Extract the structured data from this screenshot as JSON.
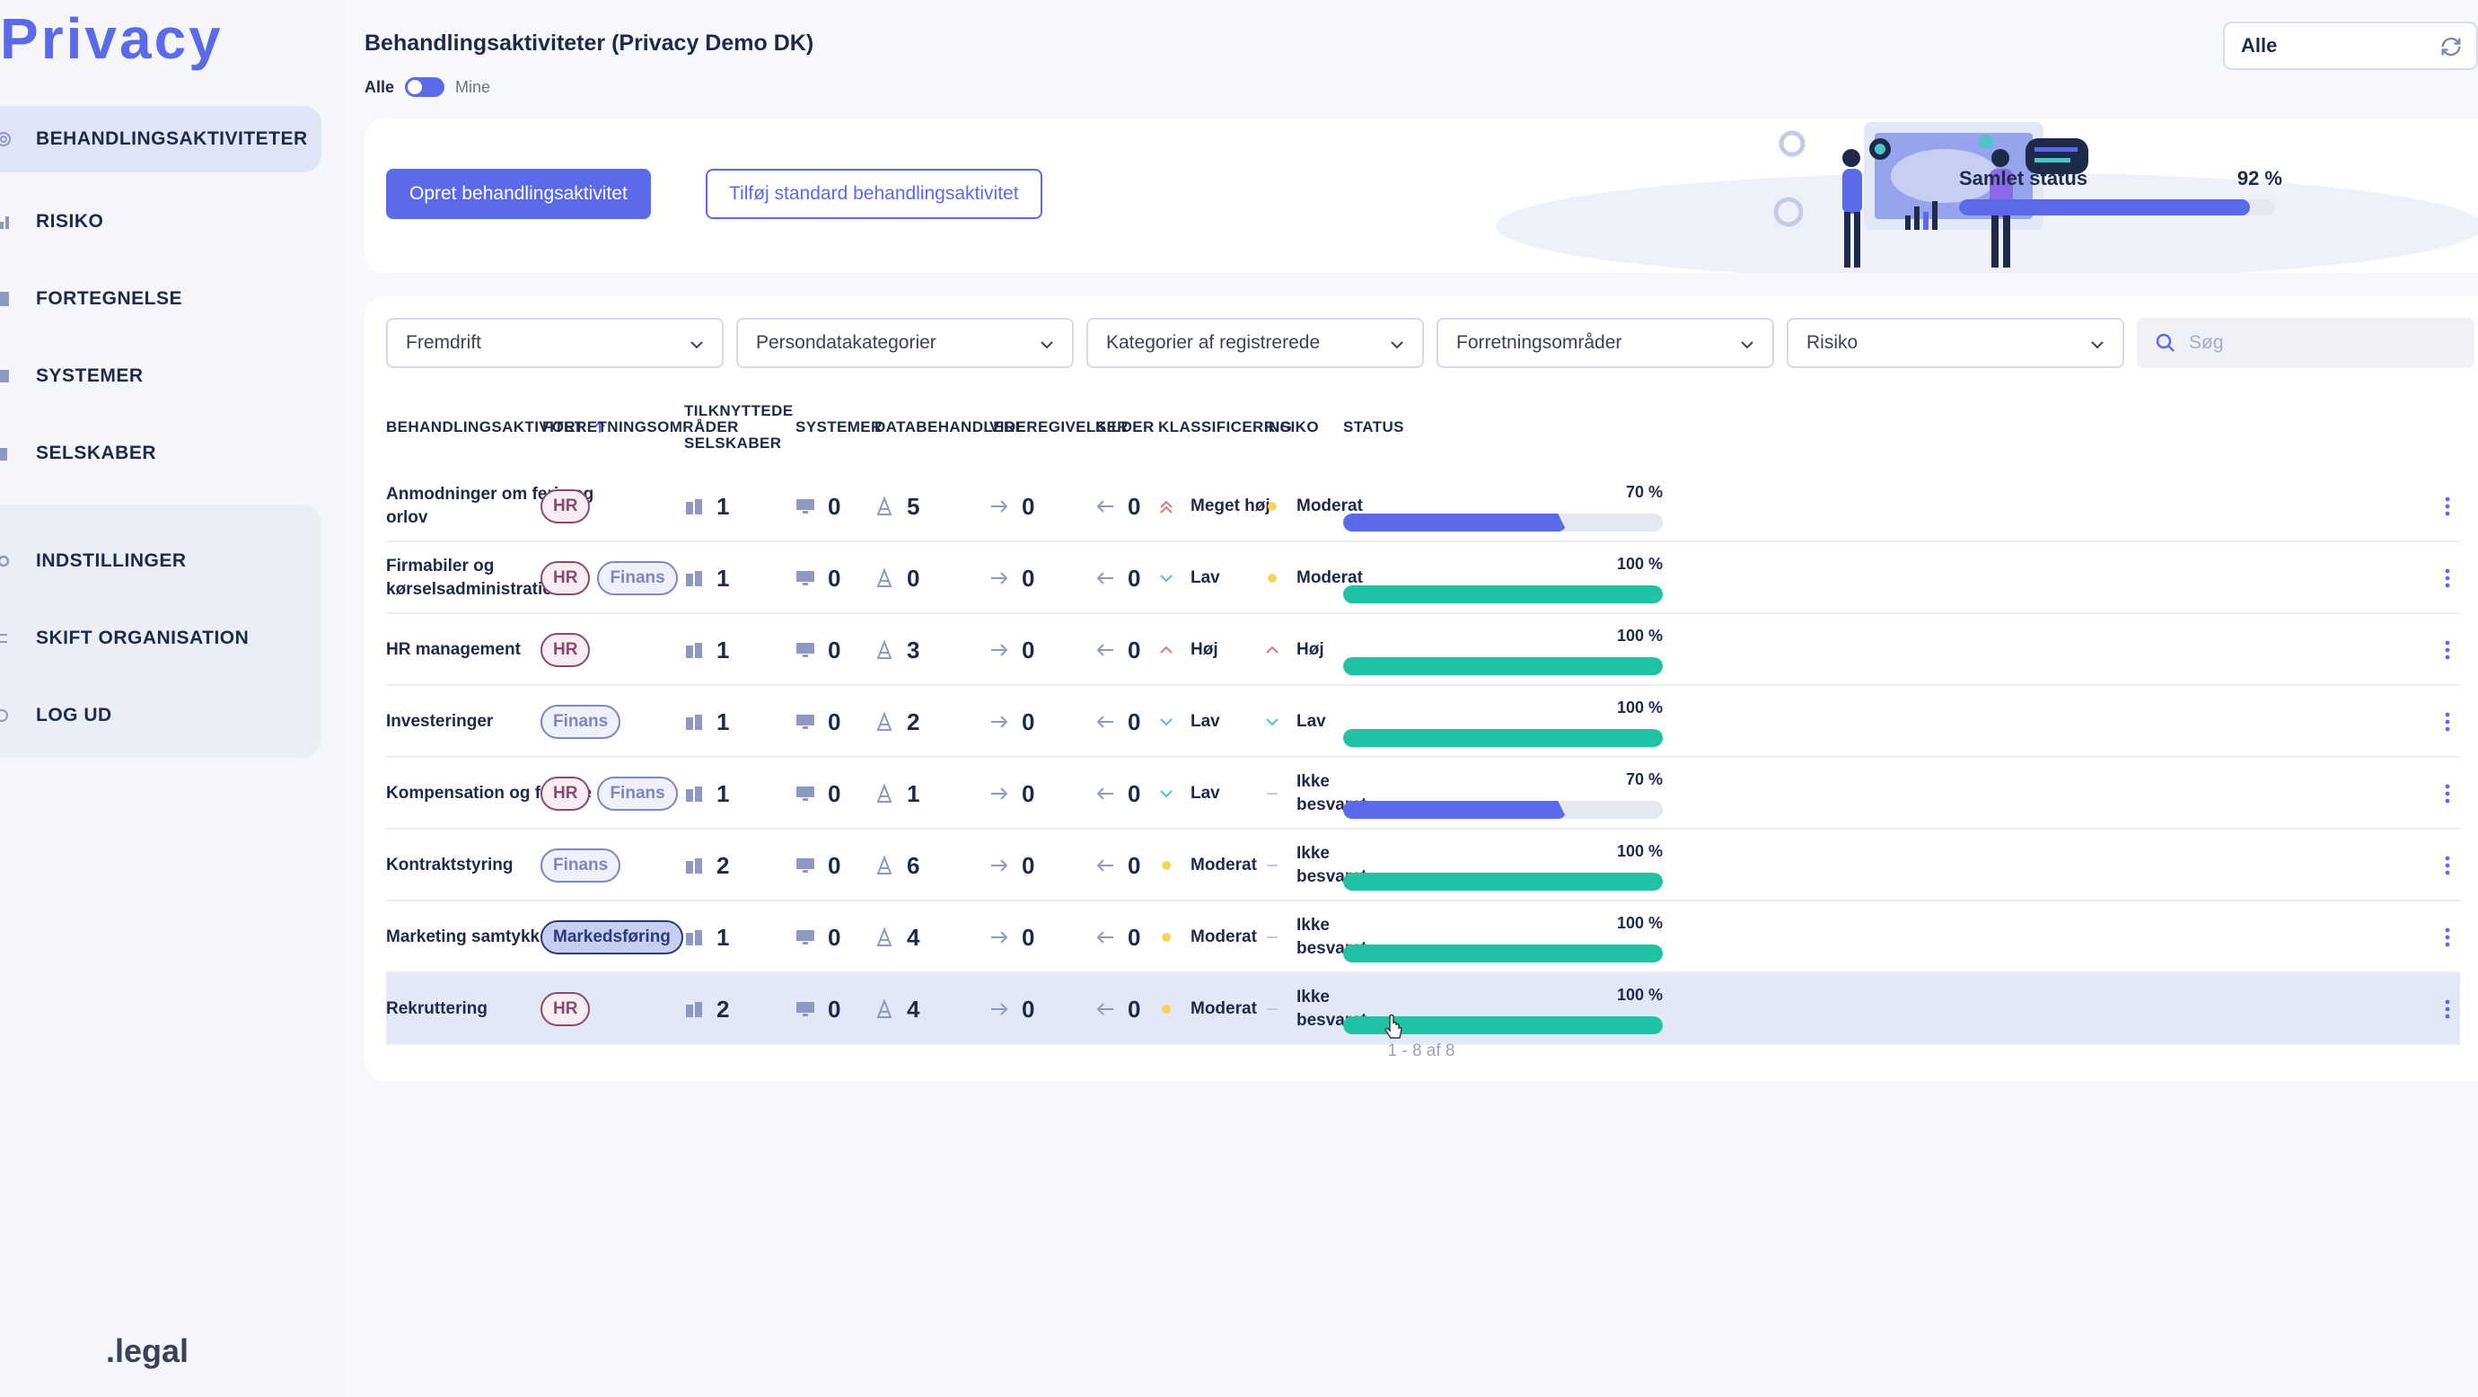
{
  "app": {
    "logo": "Privacy",
    "footer_brand": ".legal"
  },
  "sidebar": {
    "primary": [
      {
        "label": "BEHANDLINGSAKTIVITETER",
        "icon": "target-icon",
        "active": true
      },
      {
        "label": "RISIKO",
        "icon": "chart-icon",
        "active": false
      },
      {
        "label": "FORTEGNELSE",
        "icon": "document-icon",
        "active": false
      },
      {
        "label": "SYSTEMER",
        "icon": "list-icon",
        "active": false
      },
      {
        "label": "SELSKABER",
        "icon": "building-icon",
        "active": false
      }
    ],
    "secondary": [
      {
        "label": "INDSTILLINGER",
        "icon": "gear-icon"
      },
      {
        "label": "SKIFT ORGANISATION",
        "icon": "swap-icon"
      },
      {
        "label": "LOG UD",
        "icon": "logout-icon"
      }
    ]
  },
  "header": {
    "title": "Behandlingsaktiviteter (Privacy Demo DK)",
    "toggle_left": "Alle",
    "toggle_right": "Mine",
    "org_select": "Alle"
  },
  "banner": {
    "create_button": "Opret behandlingsaktivitet",
    "standard_button": "Tilføj standard behandlingsaktivitet",
    "overall_label": "Samlet status",
    "overall_pct": "92 %",
    "overall_value": 92
  },
  "filters": {
    "progress": "Fremdrift",
    "data_categories": "Persondatakategorier",
    "subject_categories": "Kategorier af registrerede",
    "business_areas": "Forretningsområder",
    "risk": "Risiko",
    "search_placeholder": "Søg"
  },
  "table": {
    "headers": {
      "activity": "BEHANDLINGSAKTIVITET",
      "business": "FORRETNINGSOMRÅDER",
      "companies_1": "TILKNYTTEDE",
      "companies_2": "SELSKABER",
      "systems": "SYSTEMER",
      "processors": "DATABEHANDLERE",
      "disclosures": "VIDEREGIVELSER",
      "sources": "KILDER",
      "classification": "KLASSIFICERING",
      "risk": "RISIKO",
      "status": "STATUS"
    },
    "rows": [
      {
        "name": "Anmodninger om ferie og orlov",
        "tags": [
          "HR"
        ],
        "companies": "1",
        "systems": "0",
        "processors": "5",
        "disclosures": "0",
        "sources": "0",
        "classification": "Meget høj",
        "cls_icon": "double-chevron-up-icon",
        "cls_color": "#e57373",
        "risk": "Moderat",
        "risk_icon": "dot-icon",
        "risk_color": "#f6d55c",
        "status_pct": "70 %",
        "status_value": 70,
        "status_color": "blue"
      },
      {
        "name": "Firmabiler og kørselsadministration",
        "tags": [
          "HR",
          "Finans"
        ],
        "companies": "1",
        "systems": "0",
        "processors": "0",
        "disclosures": "0",
        "sources": "0",
        "classification": "Lav",
        "cls_icon": "chevron-down-icon",
        "cls_color": "#4fc3c7",
        "risk": "Moderat",
        "risk_icon": "dot-icon",
        "risk_color": "#f6d55c",
        "status_pct": "100 %",
        "status_value": 100,
        "status_color": "green"
      },
      {
        "name": "HR management",
        "tags": [
          "HR"
        ],
        "companies": "1",
        "systems": "0",
        "processors": "3",
        "disclosures": "0",
        "sources": "0",
        "classification": "Høj",
        "cls_icon": "chevron-up-icon",
        "cls_color": "#e57373",
        "risk": "Høj",
        "risk_icon": "chevron-up-icon",
        "risk_color": "#e57373",
        "status_pct": "100 %",
        "status_value": 100,
        "status_color": "green"
      },
      {
        "name": "Investeringer",
        "tags": [
          "Finans"
        ],
        "companies": "1",
        "systems": "0",
        "processors": "2",
        "disclosures": "0",
        "sources": "0",
        "classification": "Lav",
        "cls_icon": "chevron-down-icon",
        "cls_color": "#4fc3c7",
        "risk": "Lav",
        "risk_icon": "chevron-down-icon",
        "risk_color": "#4fc3c7",
        "status_pct": "100 %",
        "status_value": 100,
        "status_color": "green"
      },
      {
        "name": "Kompensation og fordele",
        "tags": [
          "HR",
          "Finans"
        ],
        "companies": "1",
        "systems": "0",
        "processors": "1",
        "disclosures": "0",
        "sources": "0",
        "classification": "Lav",
        "cls_icon": "chevron-down-icon",
        "cls_color": "#4fc3c7",
        "risk": "Ikke besvaret",
        "risk_icon": "dash-icon",
        "risk_color": "#c5c9d6",
        "status_pct": "70 %",
        "status_value": 70,
        "status_color": "blue"
      },
      {
        "name": "Kontraktstyring",
        "tags": [
          "Finans"
        ],
        "companies": "2",
        "systems": "0",
        "processors": "6",
        "disclosures": "0",
        "sources": "0",
        "classification": "Moderat",
        "cls_icon": "dot-icon",
        "cls_color": "#f6d55c",
        "risk": "Ikke besvaret",
        "risk_icon": "dash-icon",
        "risk_color": "#c5c9d6",
        "status_pct": "100 %",
        "status_value": 100,
        "status_color": "green"
      },
      {
        "name": "Marketing samtykke",
        "tags": [
          "Markedsføring"
        ],
        "companies": "1",
        "systems": "0",
        "processors": "4",
        "disclosures": "0",
        "sources": "0",
        "classification": "Moderat",
        "cls_icon": "dot-icon",
        "cls_color": "#f6d55c",
        "risk": "Ikke besvaret",
        "risk_icon": "dash-icon",
        "risk_color": "#c5c9d6",
        "status_pct": "100 %",
        "status_value": 100,
        "status_color": "green"
      },
      {
        "name": "Rekruttering",
        "tags": [
          "HR"
        ],
        "companies": "2",
        "systems": "0",
        "processors": "4",
        "disclosures": "0",
        "sources": "0",
        "classification": "Moderat",
        "cls_icon": "dot-icon",
        "cls_color": "#f6d55c",
        "risk": "Ikke besvaret",
        "risk_icon": "dash-icon",
        "risk_color": "#c5c9d6",
        "status_pct": "100 %",
        "status_value": 100,
        "status_color": "green",
        "selected": true
      }
    ],
    "pagination": "1 - 8 af 8"
  },
  "colors": {
    "accent": "#5b6ae8",
    "progress_green": "#1fc3a4",
    "text": "#1e2a4a"
  }
}
